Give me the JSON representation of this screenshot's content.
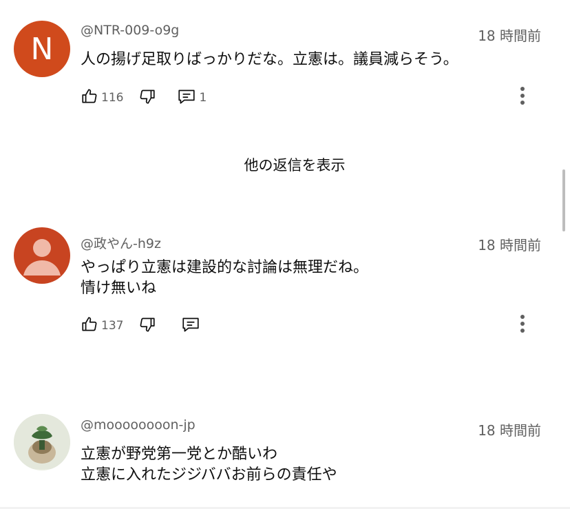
{
  "comments": [
    {
      "avatar_letter": "N",
      "author": "@NTR-009-o9g",
      "time": "18 時間前",
      "text": "人の揚げ足取りばっかりだな。立憲は。議員減らそう。",
      "likes": "116",
      "replies": "1"
    },
    {
      "author": "@政やん-h9z",
      "time": "18 時間前",
      "text": "やっぱり立憲は建設的な討論は無理だね。\n情け無いね",
      "likes": "137"
    },
    {
      "author": "@moooooooon-jp",
      "time": "18 時間前",
      "text": "立憲が野党第一党とか酷いわ\n立憲に入れたジジババお前らの責任や"
    }
  ],
  "more_replies_label": "他の返信を表示",
  "icons": [
    "like-icon",
    "dislike-icon",
    "reply-icon",
    "more-vert-icon"
  ],
  "colors": {
    "avatar_n": "#d04a1c",
    "avatar_default": "#c84421",
    "secondary_text": "#606060"
  }
}
